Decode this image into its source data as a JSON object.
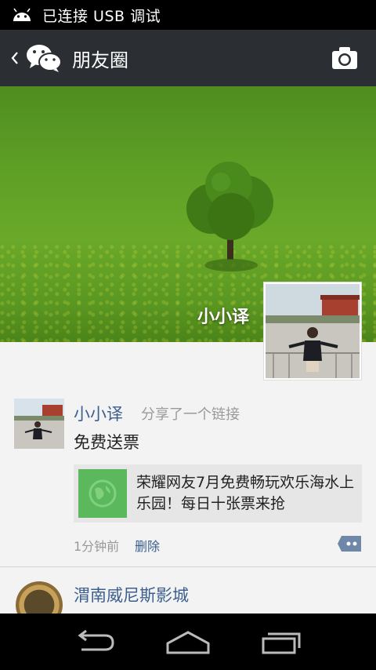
{
  "status_bar": {
    "text": "已连接 USB 调试"
  },
  "action_bar": {
    "title": "朋友圈"
  },
  "profile": {
    "name": "小小译"
  },
  "posts": [
    {
      "user": "小小译",
      "action": "分享了一个链接",
      "text": "免费送票",
      "link_title": "荣耀网友7月免费畅玩欢乐海水上乐园！每日十张票来抢",
      "time": "1分钟前",
      "delete_label": "删除"
    },
    {
      "user": "渭南威尼斯影城"
    }
  ],
  "icons": {
    "status": "android-icon",
    "back": "back-chevron-icon",
    "logo": "wechat-logo-icon",
    "camera": "camera-icon",
    "comment": "comment-icon"
  }
}
